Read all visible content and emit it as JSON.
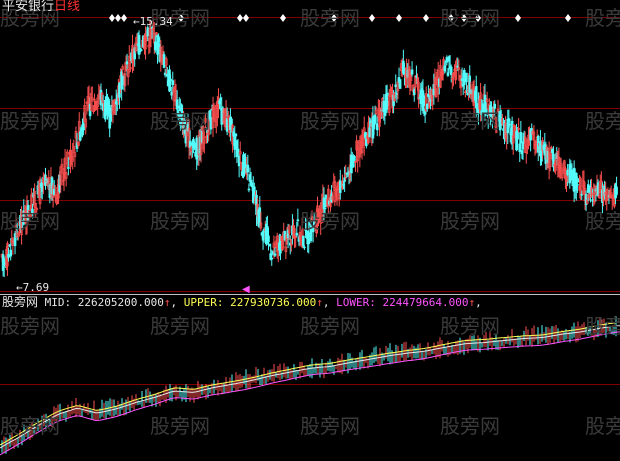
{
  "colors": {
    "background": "#000000",
    "up": "#ff5050",
    "down": "#54fcfc",
    "divider": "#800000",
    "mid": "#e8e8e8",
    "upper": "#ffff54",
    "lower": "#ff54ff",
    "signal": "#ffffff"
  },
  "header": {
    "stock_name": "平安银行",
    "period": "日线"
  },
  "main_chart": {
    "high_label": "15.34",
    "low_label": "7.69"
  },
  "indicator": {
    "name": "股旁网",
    "mid_label": "MID:",
    "mid_value": "226205200.000",
    "upper_label": "UPPER:",
    "upper_value": "227930736.000",
    "lower_label": "LOWER:",
    "lower_value": "224479664.000",
    "up_arrow": "↑",
    "separator": ","
  },
  "watermark": "股旁网",
  "chart_data": {
    "type": "candlestick",
    "price_close": [
      8.2,
      8.9,
      9.6,
      10.1,
      10.6,
      10.4,
      11.2,
      12.0,
      12.9,
      13.3,
      12.6,
      13.6,
      14.4,
      14.9,
      15.1,
      14.2,
      13.2,
      12.1,
      11.6,
      12.4,
      12.9,
      12.3,
      11.4,
      10.5,
      9.4,
      8.6,
      8.9,
      9.3,
      9.0,
      9.6,
      10.2,
      10.5,
      11.1,
      11.8,
      12.2,
      12.8,
      13.2,
      14.0,
      13.6,
      13.0,
      13.5,
      14.2,
      13.9,
      13.5,
      13.0,
      12.8,
      12.4,
      12.1,
      11.8,
      12.0,
      11.5,
      11.3,
      11.0,
      10.6,
      10.3,
      10.5,
      10.2,
      10.4
    ],
    "mid_trend": [
      0.05,
      0.12,
      0.2,
      0.28,
      0.33,
      0.3,
      0.33,
      0.37,
      0.4,
      0.44,
      0.43,
      0.47,
      0.5,
      0.53,
      0.56,
      0.58,
      0.6,
      0.61,
      0.64,
      0.67,
      0.7,
      0.72,
      0.73,
      0.75,
      0.77,
      0.78,
      0.8,
      0.82,
      0.83,
      0.85,
      0.86,
      0.88,
      0.9
    ],
    "signal_markers": 24
  }
}
